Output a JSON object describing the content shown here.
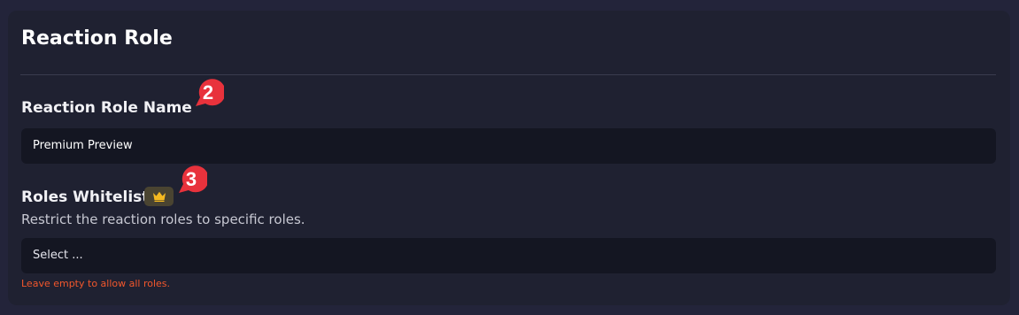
{
  "panel": {
    "title": "Reaction Role"
  },
  "fields": {
    "name": {
      "label": "Reaction Role Name",
      "value": "Premium Preview"
    },
    "roles_whitelist": {
      "label": "Roles Whitelist",
      "description": "Restrict the reaction roles to specific roles.",
      "select_value": "Select ...",
      "hint": "Leave empty to allow all roles.",
      "badge_icon": "crown-icon"
    }
  },
  "callouts": {
    "first": "2",
    "second": "3"
  },
  "colors": {
    "page_background": "#23243a",
    "panel_background": "#1f2131",
    "input_background": "#141622",
    "hint_text": "#f2572c",
    "premium_badge_background": "#4a4431",
    "crown": "#f5b921",
    "callout": "#e8323c"
  }
}
